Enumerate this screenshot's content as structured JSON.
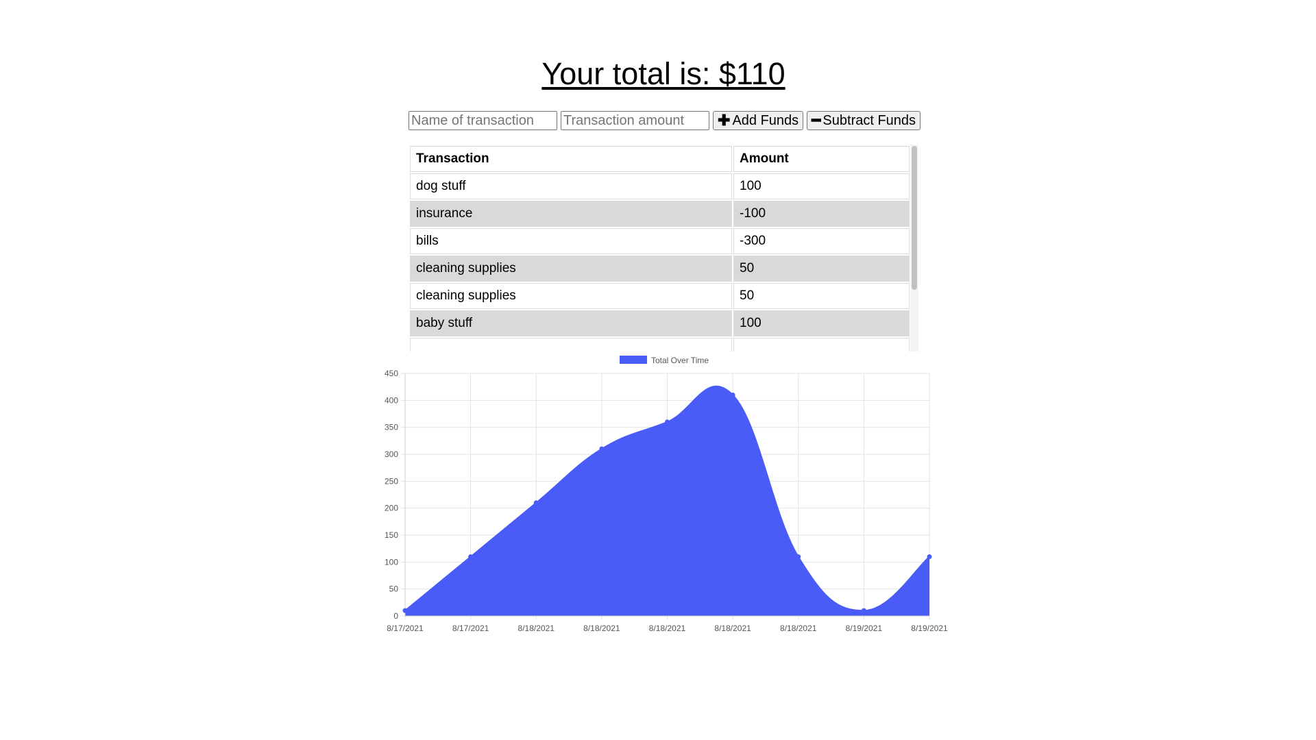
{
  "header": {
    "total_text": "Your total is: $110"
  },
  "form": {
    "name_placeholder": "Name of transaction",
    "amount_placeholder": "Transaction amount",
    "add_label": "Add Funds",
    "add_icon": "plus-icon",
    "subtract_label": "Subtract Funds",
    "subtract_icon": "minus-icon"
  },
  "table": {
    "headers": [
      "Transaction",
      "Amount"
    ],
    "rows": [
      {
        "name": "dog stuff",
        "amount": "100"
      },
      {
        "name": "insurance",
        "amount": "-100"
      },
      {
        "name": "bills",
        "amount": "-300"
      },
      {
        "name": "cleaning supplies",
        "amount": "50"
      },
      {
        "name": "cleaning supplies",
        "amount": "50"
      },
      {
        "name": "baby stuff",
        "amount": "100"
      }
    ],
    "stripe_color": "#d9d9d9"
  },
  "chart_data": {
    "type": "area",
    "series": [
      {
        "name": "Total Over Time",
        "color": "#4a5cf7",
        "values": [
          10,
          110,
          210,
          310,
          360,
          410,
          110,
          10,
          110
        ]
      }
    ],
    "categories": [
      "8/17/2021",
      "8/17/2021",
      "8/18/2021",
      "8/18/2021",
      "8/18/2021",
      "8/18/2021",
      "8/18/2021",
      "8/19/2021",
      "8/19/2021"
    ],
    "ylim": [
      0,
      450
    ],
    "yticks": [
      0,
      50,
      100,
      150,
      200,
      250,
      300,
      350,
      400,
      450
    ],
    "grid": true,
    "legend": "top-center",
    "title": "",
    "xlabel": "",
    "ylabel": ""
  }
}
